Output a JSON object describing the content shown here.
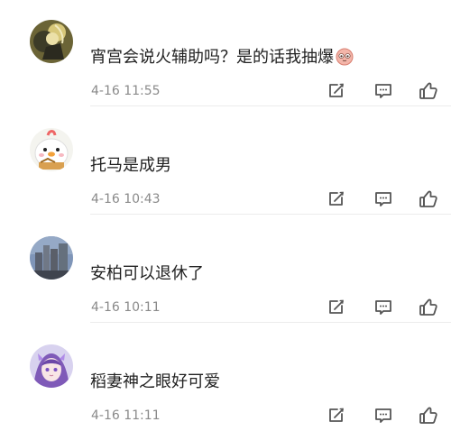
{
  "comments": [
    {
      "text": "宵宫会说火辅助吗？是的话我抽爆",
      "time": "4-16 11:55",
      "emoji": "blushing-face-emoji"
    },
    {
      "text": "托马是成男",
      "time": "4-16 10:43"
    },
    {
      "text": "安柏可以退休了",
      "time": "4-16 10:11"
    },
    {
      "text": "稻妻神之眼好可爱",
      "time": "4-16 11:11"
    }
  ],
  "icons": {
    "share": "edit-share-icon",
    "reply": "comment-reply-icon",
    "like": "thumbs-up-icon"
  },
  "colors": {
    "text": "#222222",
    "time": "#8a8a8a",
    "icon": "#555555",
    "divider": "#ececec"
  }
}
